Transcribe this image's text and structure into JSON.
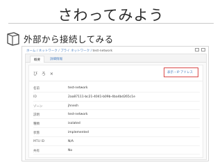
{
  "page": {
    "title": "さわってみよう",
    "subtitle": "外部から接続してみる",
    "subtitle_icon": "book-icon"
  },
  "console": {
    "breadcrumb": {
      "links": [
        "ホーム",
        "ネットワーク",
        "プライ ネットワーク"
      ],
      "separator": "/",
      "current": "test-network"
    },
    "tabs": [
      {
        "label": "概要"
      },
      {
        "label": "詳細情報"
      }
    ],
    "actions_text": "び ろ ✕",
    "highlight_button_label": "表示・IP アドレス",
    "highlight_color": "#d94a4a",
    "details": [
      {
        "key": "名前",
        "value": "test-network"
      },
      {
        "key": "ID",
        "value": "2aa87111-bc21-4041-b09b-4ba4bd265c1e"
      },
      {
        "key": "ゾーン",
        "value": "jhnesh"
      },
      {
        "key": "説明",
        "value": "test-network"
      },
      {
        "key": "種類",
        "value": "isolated"
      },
      {
        "key": "状態",
        "value": "implemented"
      },
      {
        "key": "MTU ID",
        "value": "N/A"
      },
      {
        "key": "共有",
        "value": "No"
      }
    ]
  }
}
